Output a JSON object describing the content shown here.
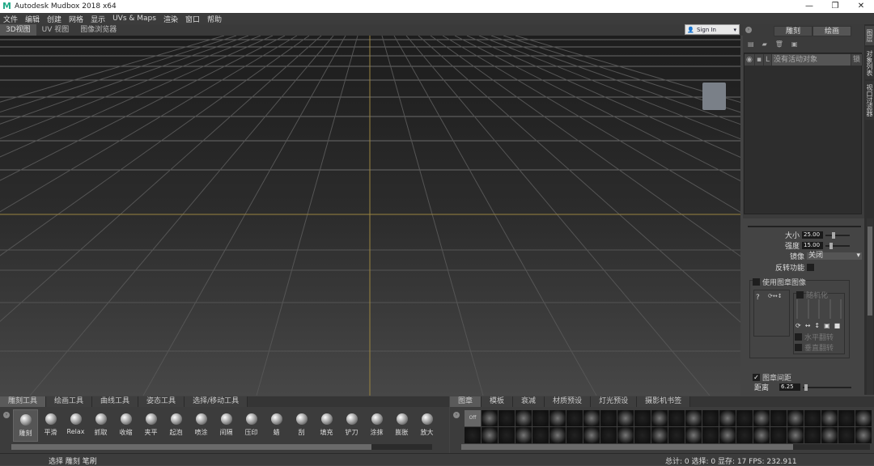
{
  "window": {
    "title": "Autodesk Mudbox 2018 x64",
    "logo": "M"
  },
  "menu": [
    "文件",
    "编辑",
    "创建",
    "网格",
    "显示",
    "UVs & Maps",
    "渲染",
    "窗口",
    "帮助"
  ],
  "view_tabs": [
    "3D视图",
    "UV 视图",
    "图像浏览器"
  ],
  "signin": "Sign In",
  "right": {
    "tabs": [
      "雕刻",
      "绘画"
    ],
    "layer_name": "没有活动对象",
    "layer_flag": "L",
    "layer_btn": "锁",
    "side_tabs": [
      "图层",
      "对象列表",
      "视口过滤器"
    ]
  },
  "props": {
    "size_label": "大小",
    "size": "25.00",
    "strength_label": "强度",
    "strength": "15.00",
    "mirror_label": "镜像",
    "mirror": "关闭",
    "invert_label": "反转功能",
    "stamp_label": "使用图章图像",
    "rand_label": "随机化",
    "hflip_label": "水平翻转",
    "vflip_label": "垂直翻转",
    "spacing_label": "图章间距",
    "dist_label": "距离",
    "dist": "6.25",
    "q": "?"
  },
  "tool_tabs": [
    "雕刻工具",
    "绘画工具",
    "曲线工具",
    "姿态工具",
    "选择/移动工具"
  ],
  "tools": [
    "雕刻",
    "平滑",
    "Relax",
    "抓取",
    "收缩",
    "夹平",
    "起泡",
    "喷涂",
    "间隔",
    "压印",
    "蜡",
    "刮",
    "填充",
    "铲刀",
    "涂抹",
    "膨胀",
    "放大"
  ],
  "stamp_tabs": [
    "图章",
    "模板",
    "衰减",
    "材质预设",
    "灯光预设",
    "摄影机书签"
  ],
  "stamp_off": "Off",
  "status": {
    "left": "选择 雕刻 笔刷",
    "right": "总计: 0  选择: 0 显存: 17  FPS: 232.911"
  }
}
